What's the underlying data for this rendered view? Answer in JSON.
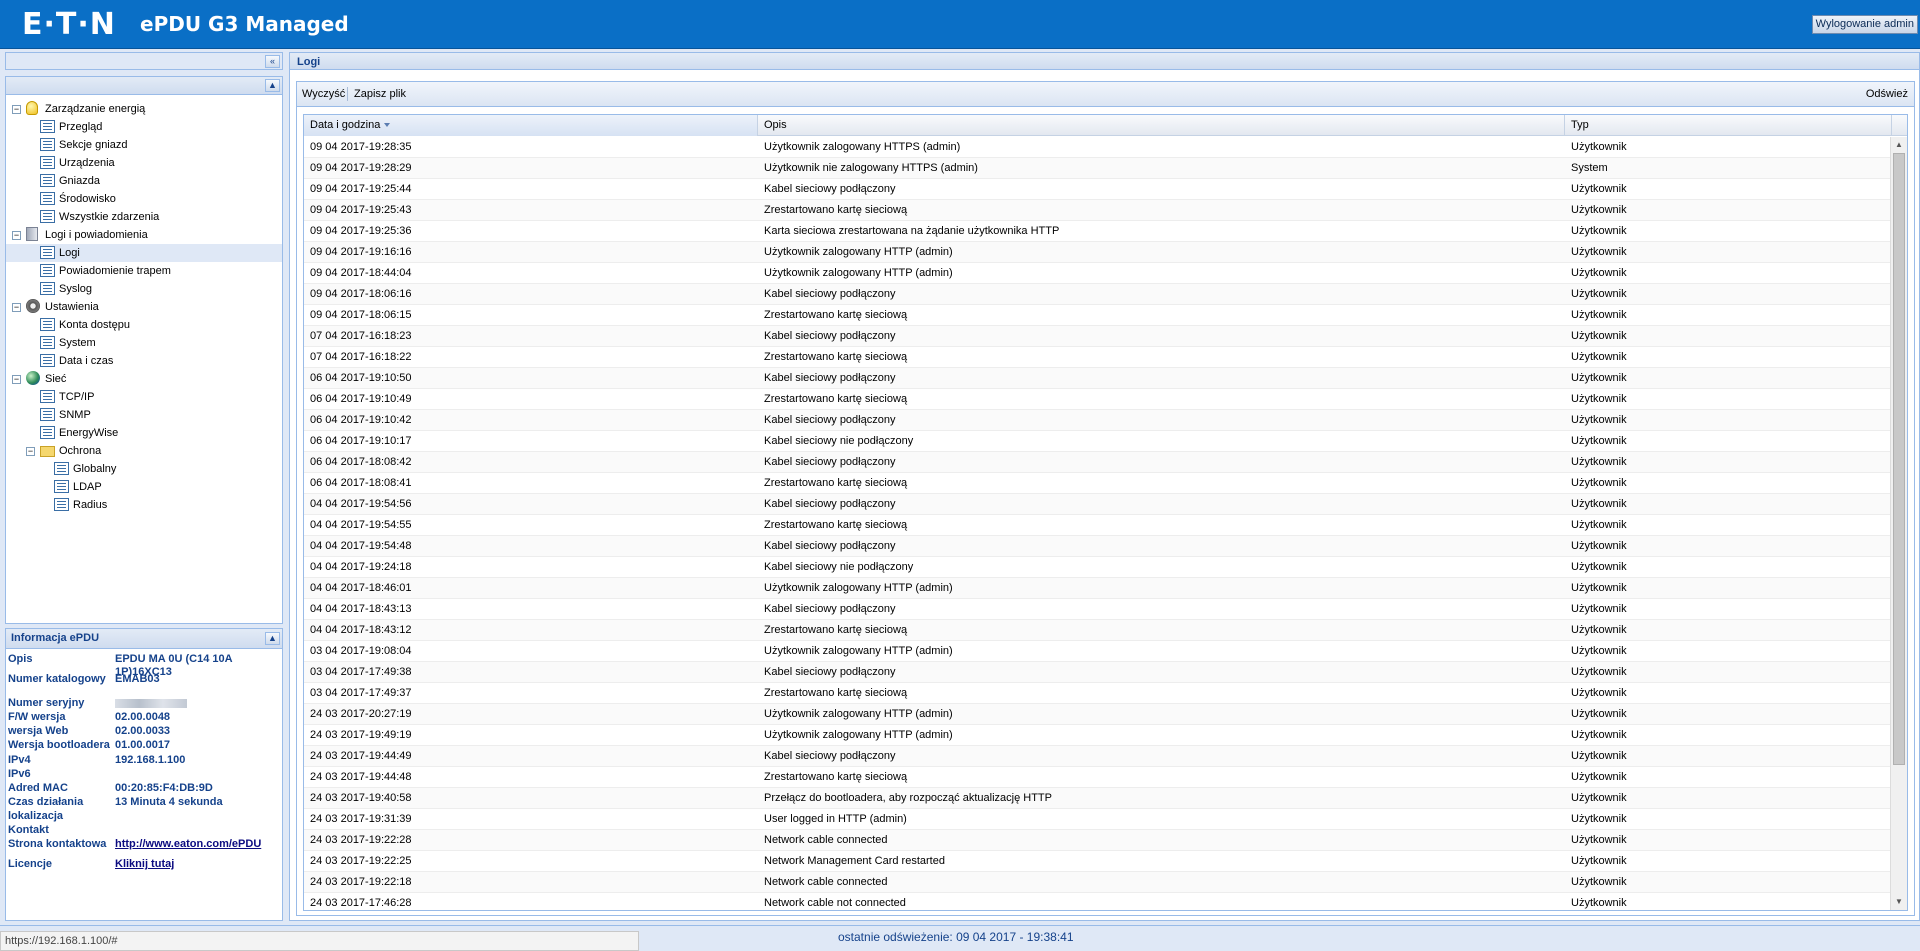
{
  "header": {
    "logo": "E·T·N",
    "title": "ePDU G3 Managed",
    "logout_label": "Wylogowanie admin"
  },
  "tree": [
    {
      "label": "Zarządzanie energią",
      "icon": "bulb-icon",
      "level": 0,
      "toggle": "−"
    },
    {
      "label": "Przegląd",
      "icon": "page-icon",
      "level": 1
    },
    {
      "label": "Sekcje gniazd",
      "icon": "page-icon",
      "level": 1
    },
    {
      "label": "Urządzenia",
      "icon": "page-icon",
      "level": 1
    },
    {
      "label": "Gniazda",
      "icon": "page-icon",
      "level": 1
    },
    {
      "label": "Środowisko",
      "icon": "page-icon",
      "level": 1
    },
    {
      "label": "Wszystkie zdarzenia",
      "icon": "page-icon",
      "level": 1
    },
    {
      "label": "Logi i powiadomienia",
      "icon": "book-icon",
      "level": 0,
      "toggle": "−"
    },
    {
      "label": "Logi",
      "icon": "page-icon",
      "level": 1,
      "selected": true
    },
    {
      "label": "Powiadomienie trapem",
      "icon": "page-icon",
      "level": 1
    },
    {
      "label": "Syslog",
      "icon": "page-icon",
      "level": 1
    },
    {
      "label": "Ustawienia",
      "icon": "gear-icon",
      "level": 0,
      "toggle": "−"
    },
    {
      "label": "Konta dostępu",
      "icon": "page-icon",
      "level": 1
    },
    {
      "label": "System",
      "icon": "page-icon",
      "level": 1
    },
    {
      "label": "Data i czas",
      "icon": "page-icon",
      "level": 1
    },
    {
      "label": "Sieć",
      "icon": "globe-icon",
      "level": 0,
      "toggle": "−"
    },
    {
      "label": "TCP/IP",
      "icon": "page-icon",
      "level": 1
    },
    {
      "label": "SNMP",
      "icon": "page-icon",
      "level": 1
    },
    {
      "label": "EnergyWise",
      "icon": "page-icon",
      "level": 1
    },
    {
      "label": "Ochrona",
      "icon": "folder-icon",
      "level": 1,
      "toggle": "−"
    },
    {
      "label": "Globalny",
      "icon": "page-icon",
      "level": 2
    },
    {
      "label": "LDAP",
      "icon": "page-icon",
      "level": 2
    },
    {
      "label": "Radius",
      "icon": "page-icon",
      "level": 2
    }
  ],
  "info": {
    "title": "Informacja ePDU",
    "rows": [
      {
        "key": "Opis",
        "value": "EPDU MA 0U (C14 10A 1P)16XC13"
      },
      {
        "key": "Numer katalogowy",
        "value": "EMAB03"
      },
      {
        "key": "Numer seryjny",
        "value": "",
        "redacted": true
      },
      {
        "key": "F/W wersja",
        "value": "02.00.0048"
      },
      {
        "key": "wersja Web",
        "value": "02.00.0033"
      },
      {
        "key": "Wersja bootloadera",
        "value": "01.00.0017"
      },
      {
        "key": "IPv4",
        "value": "192.168.1.100"
      },
      {
        "key": "IPv6",
        "value": ""
      },
      {
        "key": "Adred MAC",
        "value": "00:20:85:F4:DB:9D"
      },
      {
        "key": "Czas działania",
        "value": "13 Minuta 4 sekunda"
      },
      {
        "key": "lokalizacja",
        "value": ""
      },
      {
        "key": "Kontakt",
        "value": ""
      },
      {
        "key": "Strona kontaktowa",
        "value": "http://www.eaton.com/ePDU",
        "link": true
      },
      {
        "key": "Licencje",
        "value": "Kliknij tutaj",
        "link": true
      }
    ]
  },
  "main": {
    "title": "Logi",
    "toolbar": {
      "clear": "Wyczyść",
      "save": "Zapisz plik",
      "refresh": "Odśwież"
    },
    "columns": [
      "Data i godzina",
      "Opis",
      "Typ"
    ],
    "rows": [
      [
        "09 04 2017-19:28:35",
        "Użytkownik zalogowany HTTPS (admin)",
        "Użytkownik"
      ],
      [
        "09 04 2017-19:28:29",
        "Użytkownik nie zalogowany HTTPS (admin)",
        "System"
      ],
      [
        "09 04 2017-19:25:44",
        "Kabel sieciowy podłączony",
        "Użytkownik"
      ],
      [
        "09 04 2017-19:25:43",
        "Zrestartowano kartę sieciową",
        "Użytkownik"
      ],
      [
        "09 04 2017-19:25:36",
        "Karta sieciowa zrestartowana na żądanie użytkownika HTTP",
        "Użytkownik"
      ],
      [
        "09 04 2017-19:16:16",
        "Użytkownik zalogowany HTTP (admin)",
        "Użytkownik"
      ],
      [
        "09 04 2017-18:44:04",
        "Użytkownik zalogowany HTTP (admin)",
        "Użytkownik"
      ],
      [
        "09 04 2017-18:06:16",
        "Kabel sieciowy podłączony",
        "Użytkownik"
      ],
      [
        "09 04 2017-18:06:15",
        "Zrestartowano kartę sieciową",
        "Użytkownik"
      ],
      [
        "07 04 2017-16:18:23",
        "Kabel sieciowy podłączony",
        "Użytkownik"
      ],
      [
        "07 04 2017-16:18:22",
        "Zrestartowano kartę sieciową",
        "Użytkownik"
      ],
      [
        "06 04 2017-19:10:50",
        "Kabel sieciowy podłączony",
        "Użytkownik"
      ],
      [
        "06 04 2017-19:10:49",
        "Zrestartowano kartę sieciową",
        "Użytkownik"
      ],
      [
        "06 04 2017-19:10:42",
        "Kabel sieciowy podłączony",
        "Użytkownik"
      ],
      [
        "06 04 2017-19:10:17",
        "Kabel sieciowy nie podłączony",
        "Użytkownik"
      ],
      [
        "06 04 2017-18:08:42",
        "Kabel sieciowy podłączony",
        "Użytkownik"
      ],
      [
        "06 04 2017-18:08:41",
        "Zrestartowano kartę sieciową",
        "Użytkownik"
      ],
      [
        "04 04 2017-19:54:56",
        "Kabel sieciowy podłączony",
        "Użytkownik"
      ],
      [
        "04 04 2017-19:54:55",
        "Zrestartowano kartę sieciową",
        "Użytkownik"
      ],
      [
        "04 04 2017-19:54:48",
        "Kabel sieciowy podłączony",
        "Użytkownik"
      ],
      [
        "04 04 2017-19:24:18",
        "Kabel sieciowy nie podłączony",
        "Użytkownik"
      ],
      [
        "04 04 2017-18:46:01",
        "Użytkownik zalogowany HTTP (admin)",
        "Użytkownik"
      ],
      [
        "04 04 2017-18:43:13",
        "Kabel sieciowy podłączony",
        "Użytkownik"
      ],
      [
        "04 04 2017-18:43:12",
        "Zrestartowano kartę sieciową",
        "Użytkownik"
      ],
      [
        "03 04 2017-19:08:04",
        "Użytkownik zalogowany HTTP (admin)",
        "Użytkownik"
      ],
      [
        "03 04 2017-17:49:38",
        "Kabel sieciowy podłączony",
        "Użytkownik"
      ],
      [
        "03 04 2017-17:49:37",
        "Zrestartowano kartę sieciową",
        "Użytkownik"
      ],
      [
        "24 03 2017-20:27:19",
        "Użytkownik zalogowany HTTP (admin)",
        "Użytkownik"
      ],
      [
        "24 03 2017-19:49:19",
        "Użytkownik zalogowany HTTP (admin)",
        "Użytkownik"
      ],
      [
        "24 03 2017-19:44:49",
        "Kabel sieciowy podłączony",
        "Użytkownik"
      ],
      [
        "24 03 2017-19:44:48",
        "Zrestartowano kartę sieciową",
        "Użytkownik"
      ],
      [
        "24 03 2017-19:40:58",
        "Przełącz do bootloadera, aby rozpocząć aktualizację HTTP",
        "Użytkownik"
      ],
      [
        "24 03 2017-19:31:39",
        "User logged in HTTP (admin)",
        "Użytkownik"
      ],
      [
        "24 03 2017-19:22:28",
        "Network cable connected",
        "Użytkownik"
      ],
      [
        "24 03 2017-19:22:25",
        "Network Management Card restarted",
        "Użytkownik"
      ],
      [
        "24 03 2017-19:22:18",
        "Network cable connected",
        "Użytkownik"
      ],
      [
        "24 03 2017-17:46:28",
        "Network cable not connected",
        "Użytkownik"
      ]
    ]
  },
  "status": {
    "url": "https://192.168.1.100/#",
    "last_refresh": "ostatnie odświeżenie: 09 04 2017 - 19:38:41"
  }
}
